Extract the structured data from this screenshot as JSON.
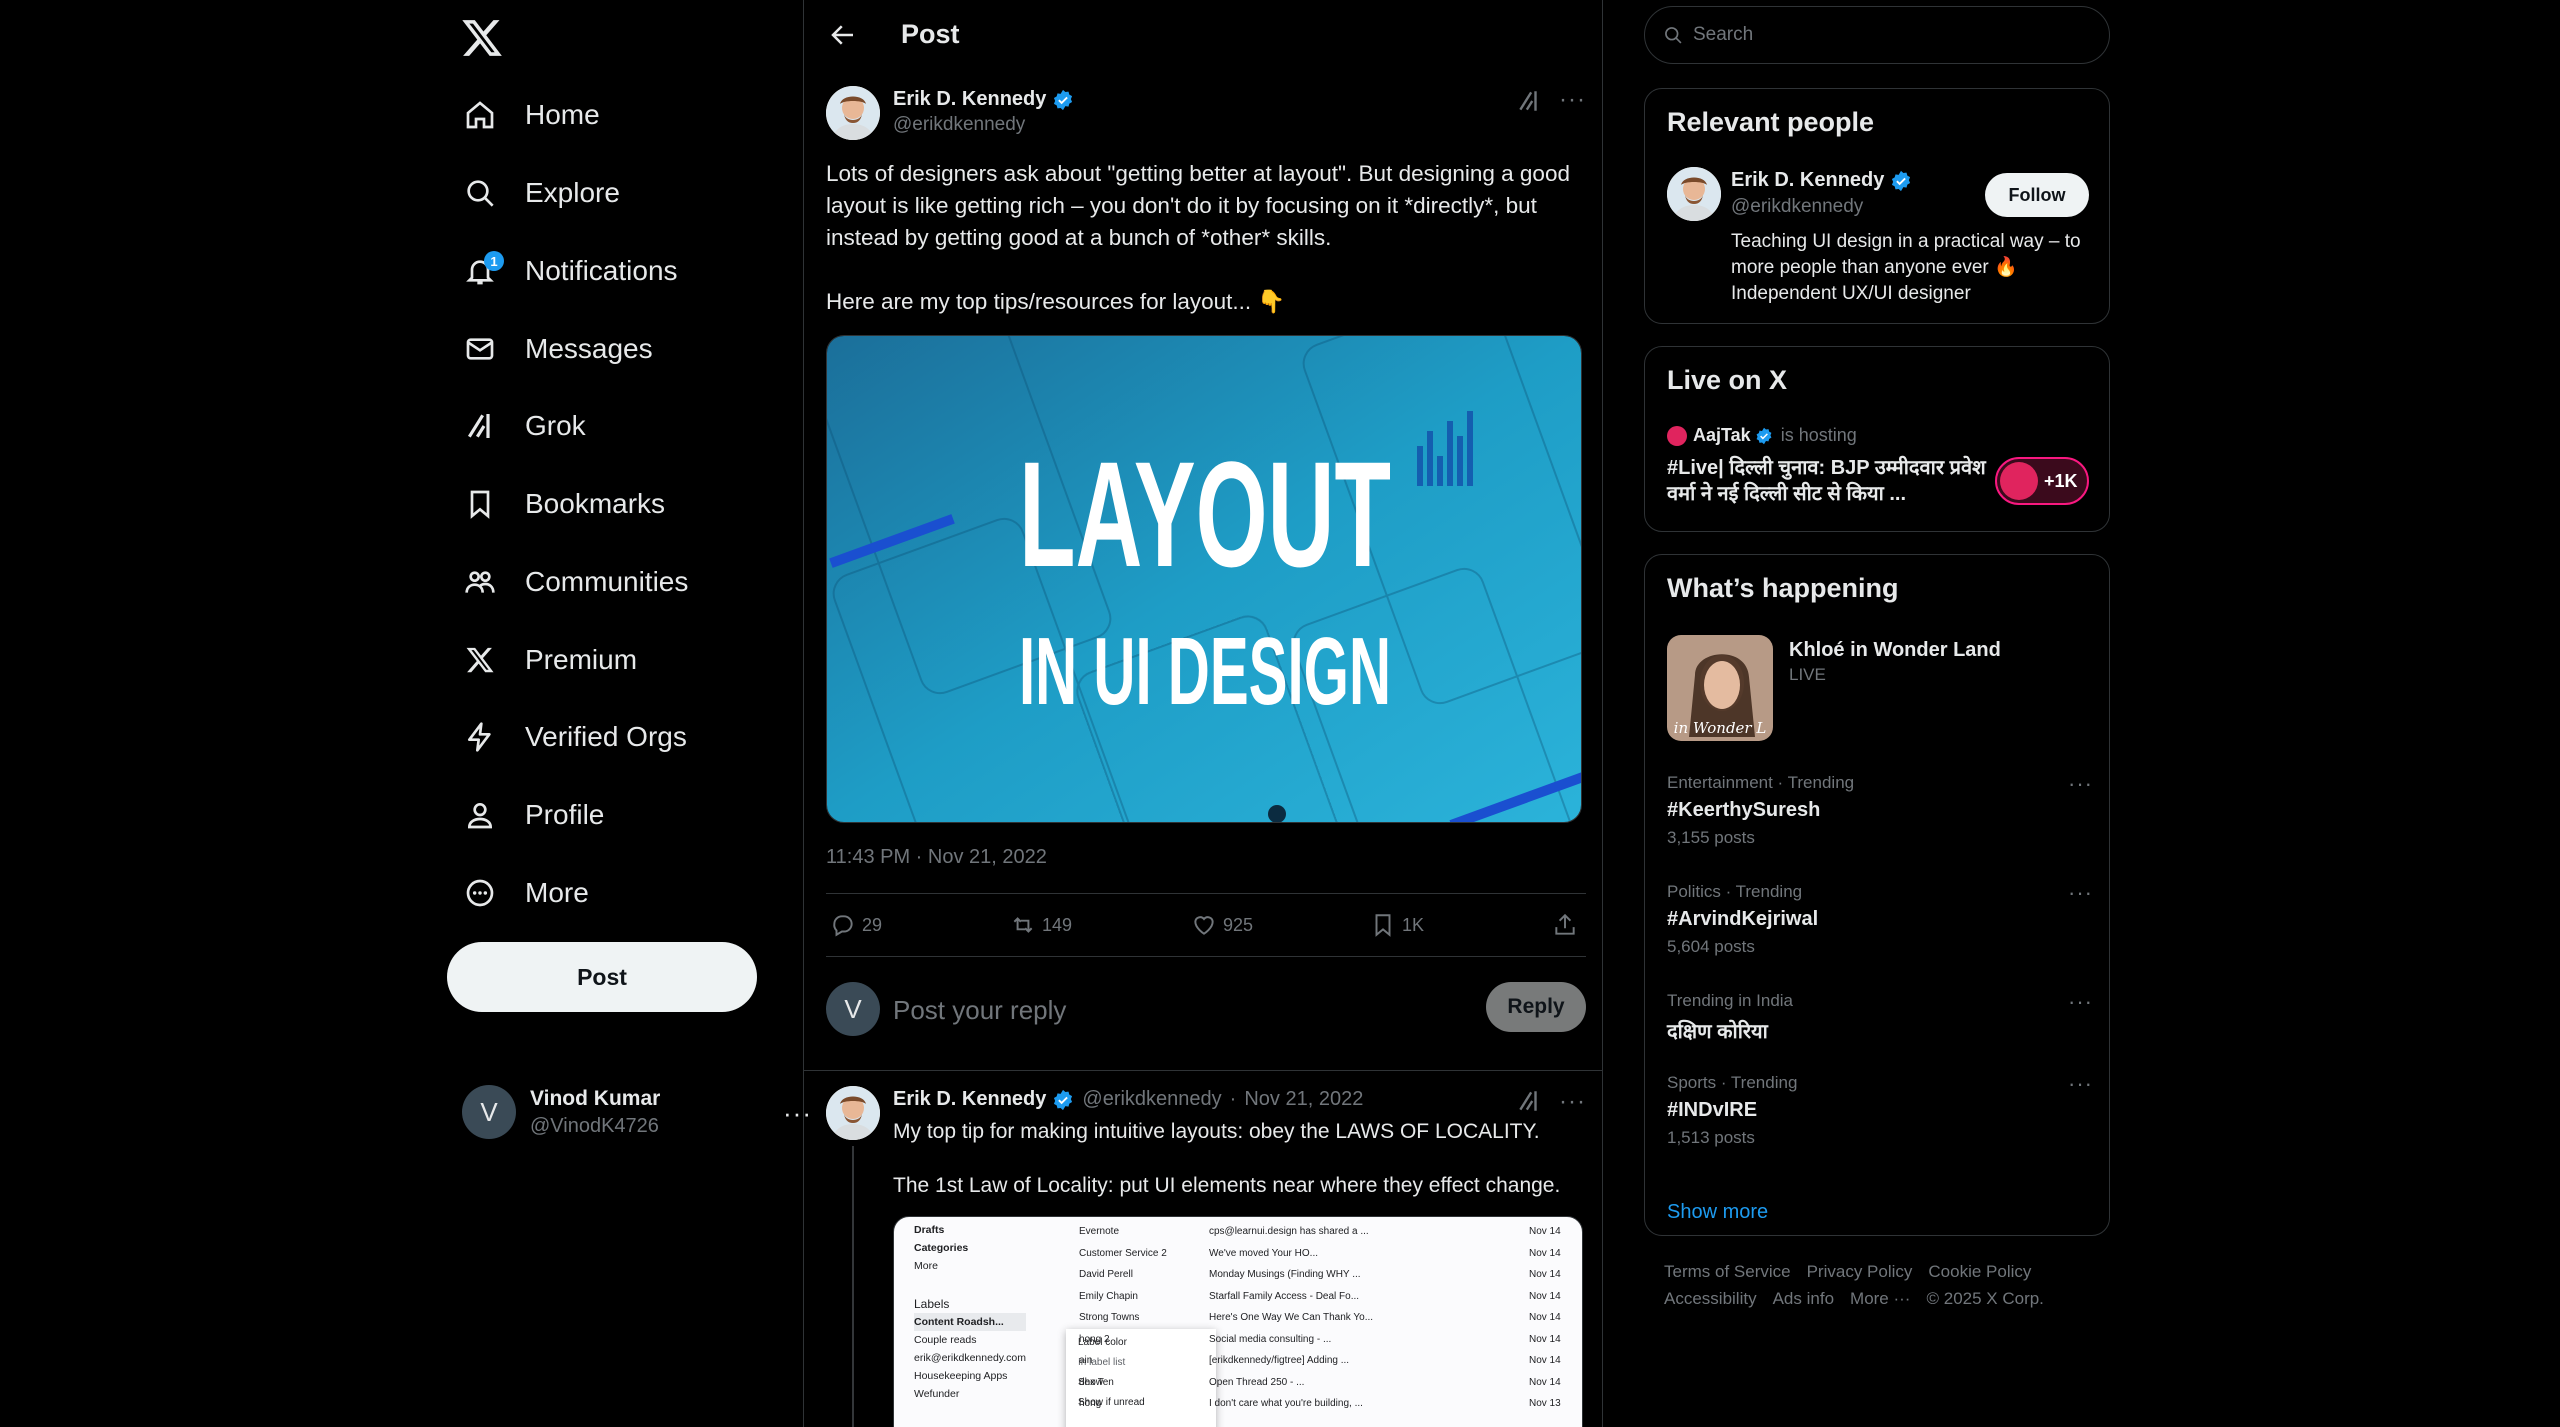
{
  "nav": {
    "items": [
      {
        "label": "Home",
        "icon": "home-icon"
      },
      {
        "label": "Explore",
        "icon": "search-icon"
      },
      {
        "label": "Notifications",
        "icon": "bell-icon",
        "badge": "1"
      },
      {
        "label": "Messages",
        "icon": "mail-icon"
      },
      {
        "label": "Grok",
        "icon": "grok-icon"
      },
      {
        "label": "Bookmarks",
        "icon": "bookmark-icon"
      },
      {
        "label": "Communities",
        "icon": "communities-icon"
      },
      {
        "label": "Premium",
        "icon": "x-logo-icon"
      },
      {
        "label": "Verified Orgs",
        "icon": "lightning-icon"
      },
      {
        "label": "Profile",
        "icon": "person-icon"
      },
      {
        "label": "More",
        "icon": "more-circle-icon"
      }
    ],
    "post_button": "Post",
    "account": {
      "initial": "V",
      "name": "Vinod Kumar",
      "handle": "@VinodK4726",
      "more": "···"
    }
  },
  "header": {
    "title": "Post"
  },
  "post": {
    "author": {
      "name": "Erik D. Kennedy",
      "handle": "@erikdkennedy"
    },
    "more": "···",
    "text": "Lots of designers ask about \"getting better at layout\". But designing a good layout is like getting rich – you don't do it by focusing on it *directly*, but instead by getting good at a bunch of *other* skills.\n\nHere are my top tips/resources for layout... 👇",
    "media": {
      "line1": "LAYOUT",
      "line2": "IN UI DESIGN"
    },
    "timestamp": "11:43 PM · Nov 21, 2022",
    "stats": {
      "replies": "29",
      "reposts": "149",
      "likes": "925",
      "bookmarks": "1K"
    }
  },
  "reply_box": {
    "initial": "V",
    "placeholder": "Post your reply",
    "button": "Reply"
  },
  "reply_post": {
    "name": "Erik D. Kennedy",
    "handle": "@erikdkennedy",
    "date": "Nov 21, 2022",
    "separator": "·",
    "more": "···",
    "text": "My top tip for making intuitive layouts: obey the LAWS OF LOCALITY.\n\nThe 1st Law of Locality: put UI elements near where they effect change.",
    "media_sidebar": [
      "Drafts",
      "Categories",
      "More",
      "Labels",
      "Content Roadsh...",
      "Couple reads",
      "erik@erikdkennedy.com",
      "Housekeeping Apps",
      "Wefunder"
    ],
    "media_rows": [
      {
        "sender": "Evernote",
        "subject": "cps@learnui.design has shared a ...",
        "date": "Nov 14"
      },
      {
        "sender": "Customer Service 2",
        "subject": "We've moved Your HO...",
        "date": "Nov 14"
      },
      {
        "sender": "David Perell",
        "subject": "Monday Musings (Finding WHY ...",
        "date": "Nov 14"
      },
      {
        "sender": "Emily Chapin",
        "subject": "Starfall Family Access - Deal Fo...",
        "date": "Nov 14"
      },
      {
        "sender": "Strong Towns",
        "subject": "Here's One Way We Can Thank Yo...",
        "date": "Nov 14"
      },
      {
        "sender": "hong 2",
        "subject": "Social media consulting - ...",
        "date": "Nov 14"
      },
      {
        "sender": "ain",
        "subject": "[erikdkennedy/figtree] Adding ...",
        "date": "Nov 14"
      },
      {
        "sender": "dex Ten",
        "subject": "Open Thread 250 - ...",
        "date": "Nov 14"
      },
      {
        "sender": "hong",
        "subject": "I don't care what you're building, ...",
        "date": "Nov 13"
      }
    ],
    "media_menu": [
      "Label color",
      "In label list",
      "Show",
      "Show if unread"
    ]
  },
  "search": {
    "placeholder": "Search"
  },
  "relevant": {
    "title": "Relevant people",
    "name": "Erik D. Kennedy",
    "handle": "@erikdkennedy",
    "follow": "Follow",
    "bio": "Teaching UI design in a practical way – to more people than anyone ever 🔥 Independent UX/UI designer"
  },
  "live": {
    "title": "Live on X",
    "host": "AajTak",
    "status": "is hosting",
    "text": "#Live| दिल्ली चुनाव: BJP उम्मीदवार प्रवेश वर्मा ने नई दिल्ली सीट से किया ...",
    "count": "+1K"
  },
  "happening": {
    "title": "What’s happening",
    "featured": {
      "title": "Khloé in Wonder Land",
      "status": "LIVE",
      "image_caption": "in Wonder L"
    },
    "trends": [
      {
        "context": "Entertainment · Trending",
        "title": "#KeerthySuresh",
        "count": "3,155 posts"
      },
      {
        "context": "Politics · Trending",
        "title": "#ArvindKejriwal",
        "count": "5,604 posts"
      },
      {
        "context": "Trending in India",
        "title": "दक्षिण कोरिया",
        "count": ""
      },
      {
        "context": "Sports · Trending",
        "title": "#INDvIRE",
        "count": "1,513 posts"
      }
    ],
    "trend_more": "···",
    "show_more": "Show more"
  },
  "footer": {
    "links": [
      "Terms of Service",
      "Privacy Policy",
      "Cookie Policy",
      "Accessibility",
      "Ads info",
      "More ···"
    ],
    "copyright": "© 2025 X Corp."
  },
  "colors": {
    "accent": "#1d9bf0",
    "background": "#000000",
    "border": "#2f3336",
    "muted": "#71767b"
  }
}
